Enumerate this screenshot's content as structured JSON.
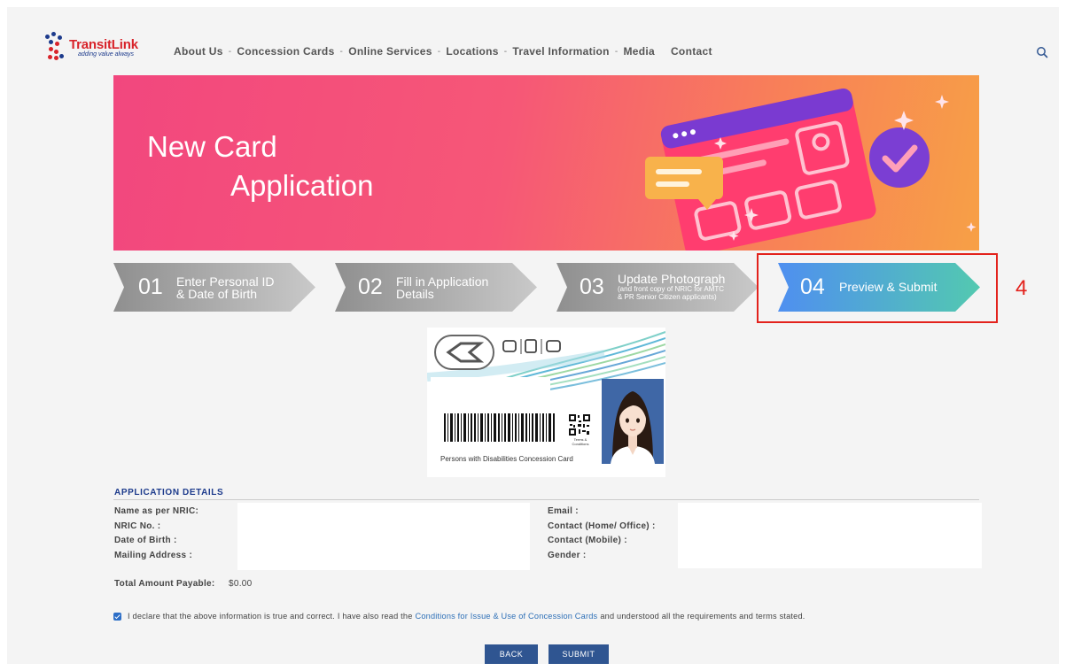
{
  "header": {
    "logo_text_transit": "Transit",
    "logo_text_link": "Link",
    "logo_tagline": "adding value always",
    "nav": [
      {
        "label": "About Us",
        "dropdown": true
      },
      {
        "label": "Concession Cards",
        "dropdown": true
      },
      {
        "label": "Online Services",
        "dropdown": true
      },
      {
        "label": "Locations",
        "dropdown": true
      },
      {
        "label": "Travel Information",
        "dropdown": true
      },
      {
        "label": "Media",
        "dropdown": false
      },
      {
        "label": "Contact",
        "dropdown": false
      }
    ],
    "nav_separator": "-",
    "search_icon": "search-icon"
  },
  "banner": {
    "title_line1": "New Card",
    "title_line2": "Application"
  },
  "steps": [
    {
      "number": "01",
      "line1": "Enter Personal ID",
      "line2": "& Date of Birth",
      "active": false
    },
    {
      "number": "02",
      "line1": "Fill in Application",
      "line2": "Details",
      "active": false
    },
    {
      "number": "03",
      "line1": "Update Photograph",
      "line2": "(and front copy of NRIC for AMTC",
      "line3": "& PR Senior Citizen applicants)",
      "active": false
    },
    {
      "number": "04",
      "line1": "Preview & Submit",
      "active": true
    }
  ],
  "annotation": "4",
  "card_preview": {
    "terms_label": "Terms & Conditions",
    "caption": "Persons with Disabilities Concession Card"
  },
  "details": {
    "title": "APPLICATION DETAILS",
    "left_labels": [
      "Name as per NRIC:",
      "NRIC No. :",
      "Date of Birth :",
      "Mailing Address :"
    ],
    "right_labels": [
      "Email :",
      "Contact (Home/ Office) :",
      "Contact (Mobile) :",
      "Gender :"
    ],
    "total_label": "Total Amount Payable:",
    "total_value": "$0.00"
  },
  "declaration": {
    "checked": true,
    "text_before": "I declare that the above information is true and correct. I have also read the",
    "link": "Conditions for Issue & Use of Concession Cards",
    "text_after": "and understood all the requirements and terms stated."
  },
  "buttons": {
    "back": "BACK",
    "submit": "SUBMIT"
  },
  "colors": {
    "brand_red": "#d8232a",
    "brand_blue": "#1d3b8c",
    "step_grey": "#9b9b9b",
    "step_active_start": "#4f8ff0",
    "step_active_end": "#53c9b0",
    "button": "#2f5591",
    "highlight": "#e3221c"
  }
}
